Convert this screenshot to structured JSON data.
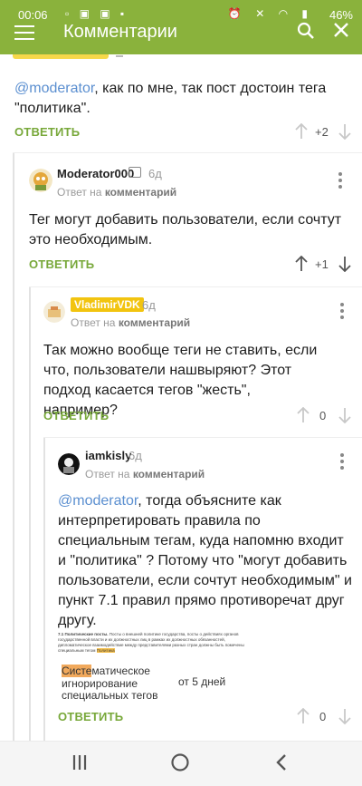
{
  "status_bar": {
    "time": "00:06",
    "battery": "46%"
  },
  "header": {
    "title": "Комментарии"
  },
  "colors": {
    "accent": "#8ab23c",
    "reply": "#78a83a",
    "mention": "#5b8fd0",
    "badge": "#f2c40f"
  },
  "comments": [
    {
      "mention": "@moderator",
      "text": ", как по мне, так пост достоин тега \"политика\".",
      "reply_label": "ОТВЕТИТЬ",
      "votes": "+2"
    },
    {
      "username": "Moderator000",
      "age": "6д",
      "reply_to_prefix": "Ответ на",
      "reply_to_target": "комментарий",
      "text": "Тег могут добавить пользователи, если сочтут это необходимым.",
      "reply_label": "ОТВЕТИТЬ",
      "votes": "+1"
    },
    {
      "username": "VladimirVDK",
      "age": "6д",
      "reply_to_prefix": "Ответ на",
      "reply_to_target": "комментарий",
      "text": "Так можно вообще теги не ставить, если что, пользователи нашвыряют? Этот подход касается тегов \"жесть\", например?",
      "reply_label": "ОТВЕТИТЬ",
      "votes": "0"
    },
    {
      "username": "iamkisly",
      "age": "6д",
      "reply_to_prefix": "Ответ на",
      "reply_to_target": "комментарий",
      "mention": "@moderator",
      "text": ", тогда объясните как интерпретировать правила по специальным тегам, куда напомню входит и \"политика\" ? Потому что \"могут добавить пользователи, если сочтут необходимым\" и пункт 7.1 правил прямо противоречат друг другу.",
      "image": {
        "rule_title": "7.1 Политические посты.",
        "rule_text": " Посты о внешней политике государства, посты о действиях органов государственной власти и их должностных лиц в рамках их должностных обязанностей, дипломатическое взаимодействие между представителями разных стран должны быть помечены специальным тегом ",
        "rule_tag": "Политика",
        "hl_part": "Систе",
        "line1_rest": "матическое",
        "line2": "игнорирование",
        "line3": "специальных тегов",
        "penalty": "от 5 дней"
      },
      "reply_label": "ОТВЕТИТЬ",
      "votes": "0"
    }
  ]
}
